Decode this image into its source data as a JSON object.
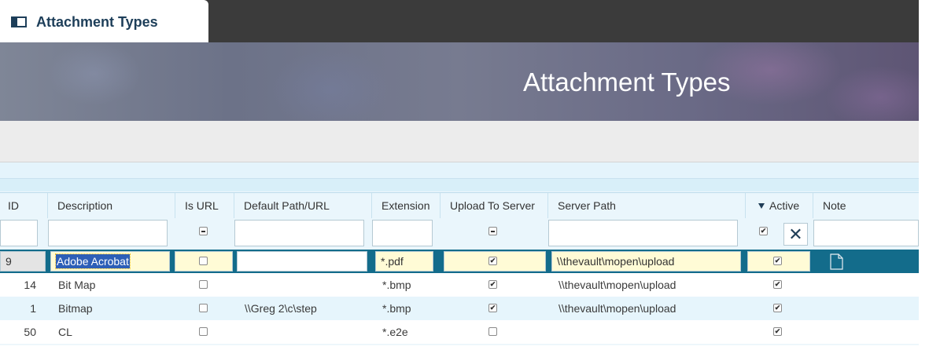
{
  "app": {
    "tab_title": "Attachment Types",
    "banner_title": "Attachment Types"
  },
  "colors": {
    "dark_bar": "#3b3b3b",
    "selected_row": "#136c8b",
    "header_text": "#1d3e59",
    "edit_cell": "#fffbd6"
  },
  "icons": {
    "tab": "panel-layout-icon",
    "clear_filter": "close-icon",
    "note": "document-icon",
    "sort": "sort-descending-icon"
  },
  "table": {
    "columns": [
      "ID",
      "Description",
      "Is URL",
      "Default Path/URL",
      "Extension",
      "Upload To Server",
      "Server Path",
      "Active",
      "Note"
    ],
    "sorted_column": "Active",
    "filters": {
      "is_url": "indeterminate",
      "upload_to_server": "indeterminate",
      "active": "checked"
    },
    "selected_row": {
      "id": "9",
      "description": "Adobe Acrobat",
      "is_url": false,
      "default_path": "",
      "extension": "*.pdf",
      "upload_to_server": true,
      "server_path": "\\\\thevault\\mopen\\upload",
      "active": true
    },
    "rows": [
      {
        "id": "14",
        "description": "Bit Map",
        "is_url": false,
        "default_path": "",
        "extension": "*.bmp",
        "upload_to_server": true,
        "server_path": "\\\\thevault\\mopen\\upload",
        "active": true
      },
      {
        "id": "1",
        "description": "Bitmap",
        "is_url": false,
        "default_path": "\\\\Greg 2\\c\\step",
        "extension": "*.bmp",
        "upload_to_server": true,
        "server_path": "\\\\thevault\\mopen\\upload",
        "active": true
      },
      {
        "id": "50",
        "description": "CL",
        "is_url": false,
        "default_path": "",
        "extension": "*.e2e",
        "upload_to_server": false,
        "server_path": "",
        "active": true
      }
    ]
  }
}
